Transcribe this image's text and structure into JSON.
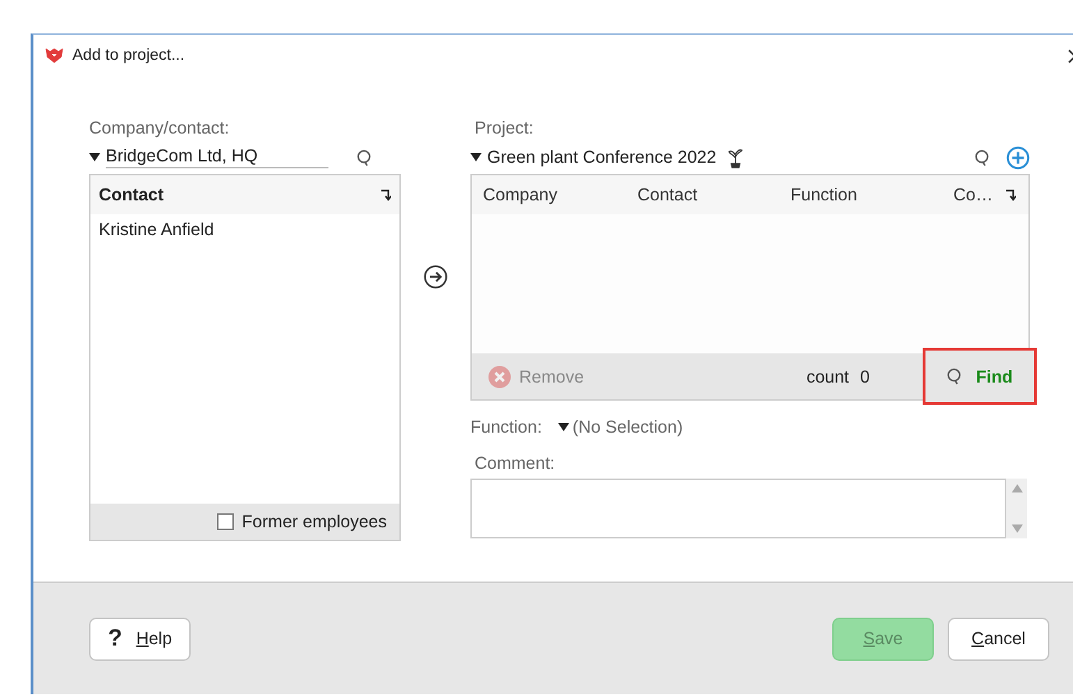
{
  "window": {
    "title": "Add to project..."
  },
  "company": {
    "label": "Company/contact:",
    "value": "BridgeCom Ltd, HQ",
    "list": {
      "columns": [
        "Contact"
      ],
      "rows": [
        "Kristine Anfield"
      ]
    },
    "former_employees": {
      "label": "Former employees",
      "checked": false
    }
  },
  "project": {
    "label": "Project:",
    "value": "Green plant Conference 2022",
    "table": {
      "columns": [
        "Company",
        "Contact",
        "Function",
        "Co…"
      ]
    },
    "remove": {
      "label": "Remove",
      "disabled": true
    },
    "count_label": "count",
    "count": "0",
    "find": {
      "label": "Find",
      "highlighted": true
    }
  },
  "function": {
    "label": "Function:",
    "value": "(No Selection)"
  },
  "comment": {
    "label": "Comment:"
  },
  "buttons": [
    {
      "kind": "help",
      "key": "H",
      "rest": "elp",
      "icon": "?"
    },
    {
      "kind": "save",
      "key": "S",
      "rest": "ave",
      "disabled": true
    },
    {
      "kind": "cancel",
      "key": "C",
      "rest": "ancel"
    }
  ]
}
